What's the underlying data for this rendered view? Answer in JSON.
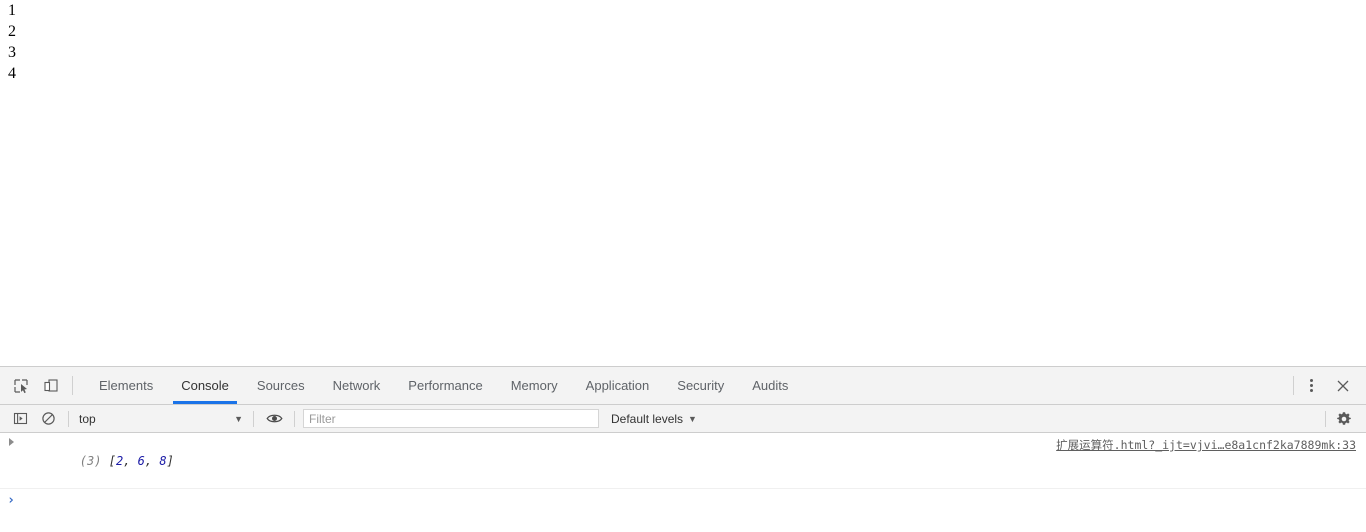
{
  "page": {
    "lines": [
      "1",
      "2",
      "3",
      "4"
    ]
  },
  "devtools": {
    "toolbar": {
      "inspect_icon": "inspect-element-icon",
      "device_icon": "device-toolbar-icon",
      "more_icon": "more-options-icon",
      "close_icon": "close-icon"
    },
    "tabs": [
      {
        "label": "Elements",
        "active": false
      },
      {
        "label": "Console",
        "active": true
      },
      {
        "label": "Sources",
        "active": false
      },
      {
        "label": "Network",
        "active": false
      },
      {
        "label": "Performance",
        "active": false
      },
      {
        "label": "Memory",
        "active": false
      },
      {
        "label": "Application",
        "active": false
      },
      {
        "label": "Security",
        "active": false
      },
      {
        "label": "Audits",
        "active": false
      }
    ],
    "console_toolbar": {
      "sidebar_icon": "console-sidebar-icon",
      "clear_icon": "clear-console-icon",
      "context_value": "top",
      "context_caret": "▼",
      "eye_icon": "live-expression-eye-icon",
      "filter_placeholder": "Filter",
      "filter_value": "",
      "levels_label": "Default levels",
      "levels_caret": "▼",
      "settings_icon": "settings-gear-icon"
    },
    "console_messages": [
      {
        "disclosure": "expand-triangle-icon",
        "count": "(3)",
        "open_bracket": "[",
        "values": [
          "2",
          "6",
          "8"
        ],
        "separator": ", ",
        "close_bracket": "]",
        "text": "(3) [2, 6, 8]",
        "source": "扩展运算符.html?_ijt=vjvi…e8a1cnf2ka7889mk:33"
      }
    ],
    "prompt": {
      "caret": "›",
      "value": ""
    }
  },
  "colors": {
    "accent": "#1a73e8",
    "toolbar_bg": "#f3f3f3",
    "border": "#cdcdcd",
    "number_literal": "#1a1aa6",
    "muted_text": "#808080",
    "prompt": "#3569c4"
  }
}
